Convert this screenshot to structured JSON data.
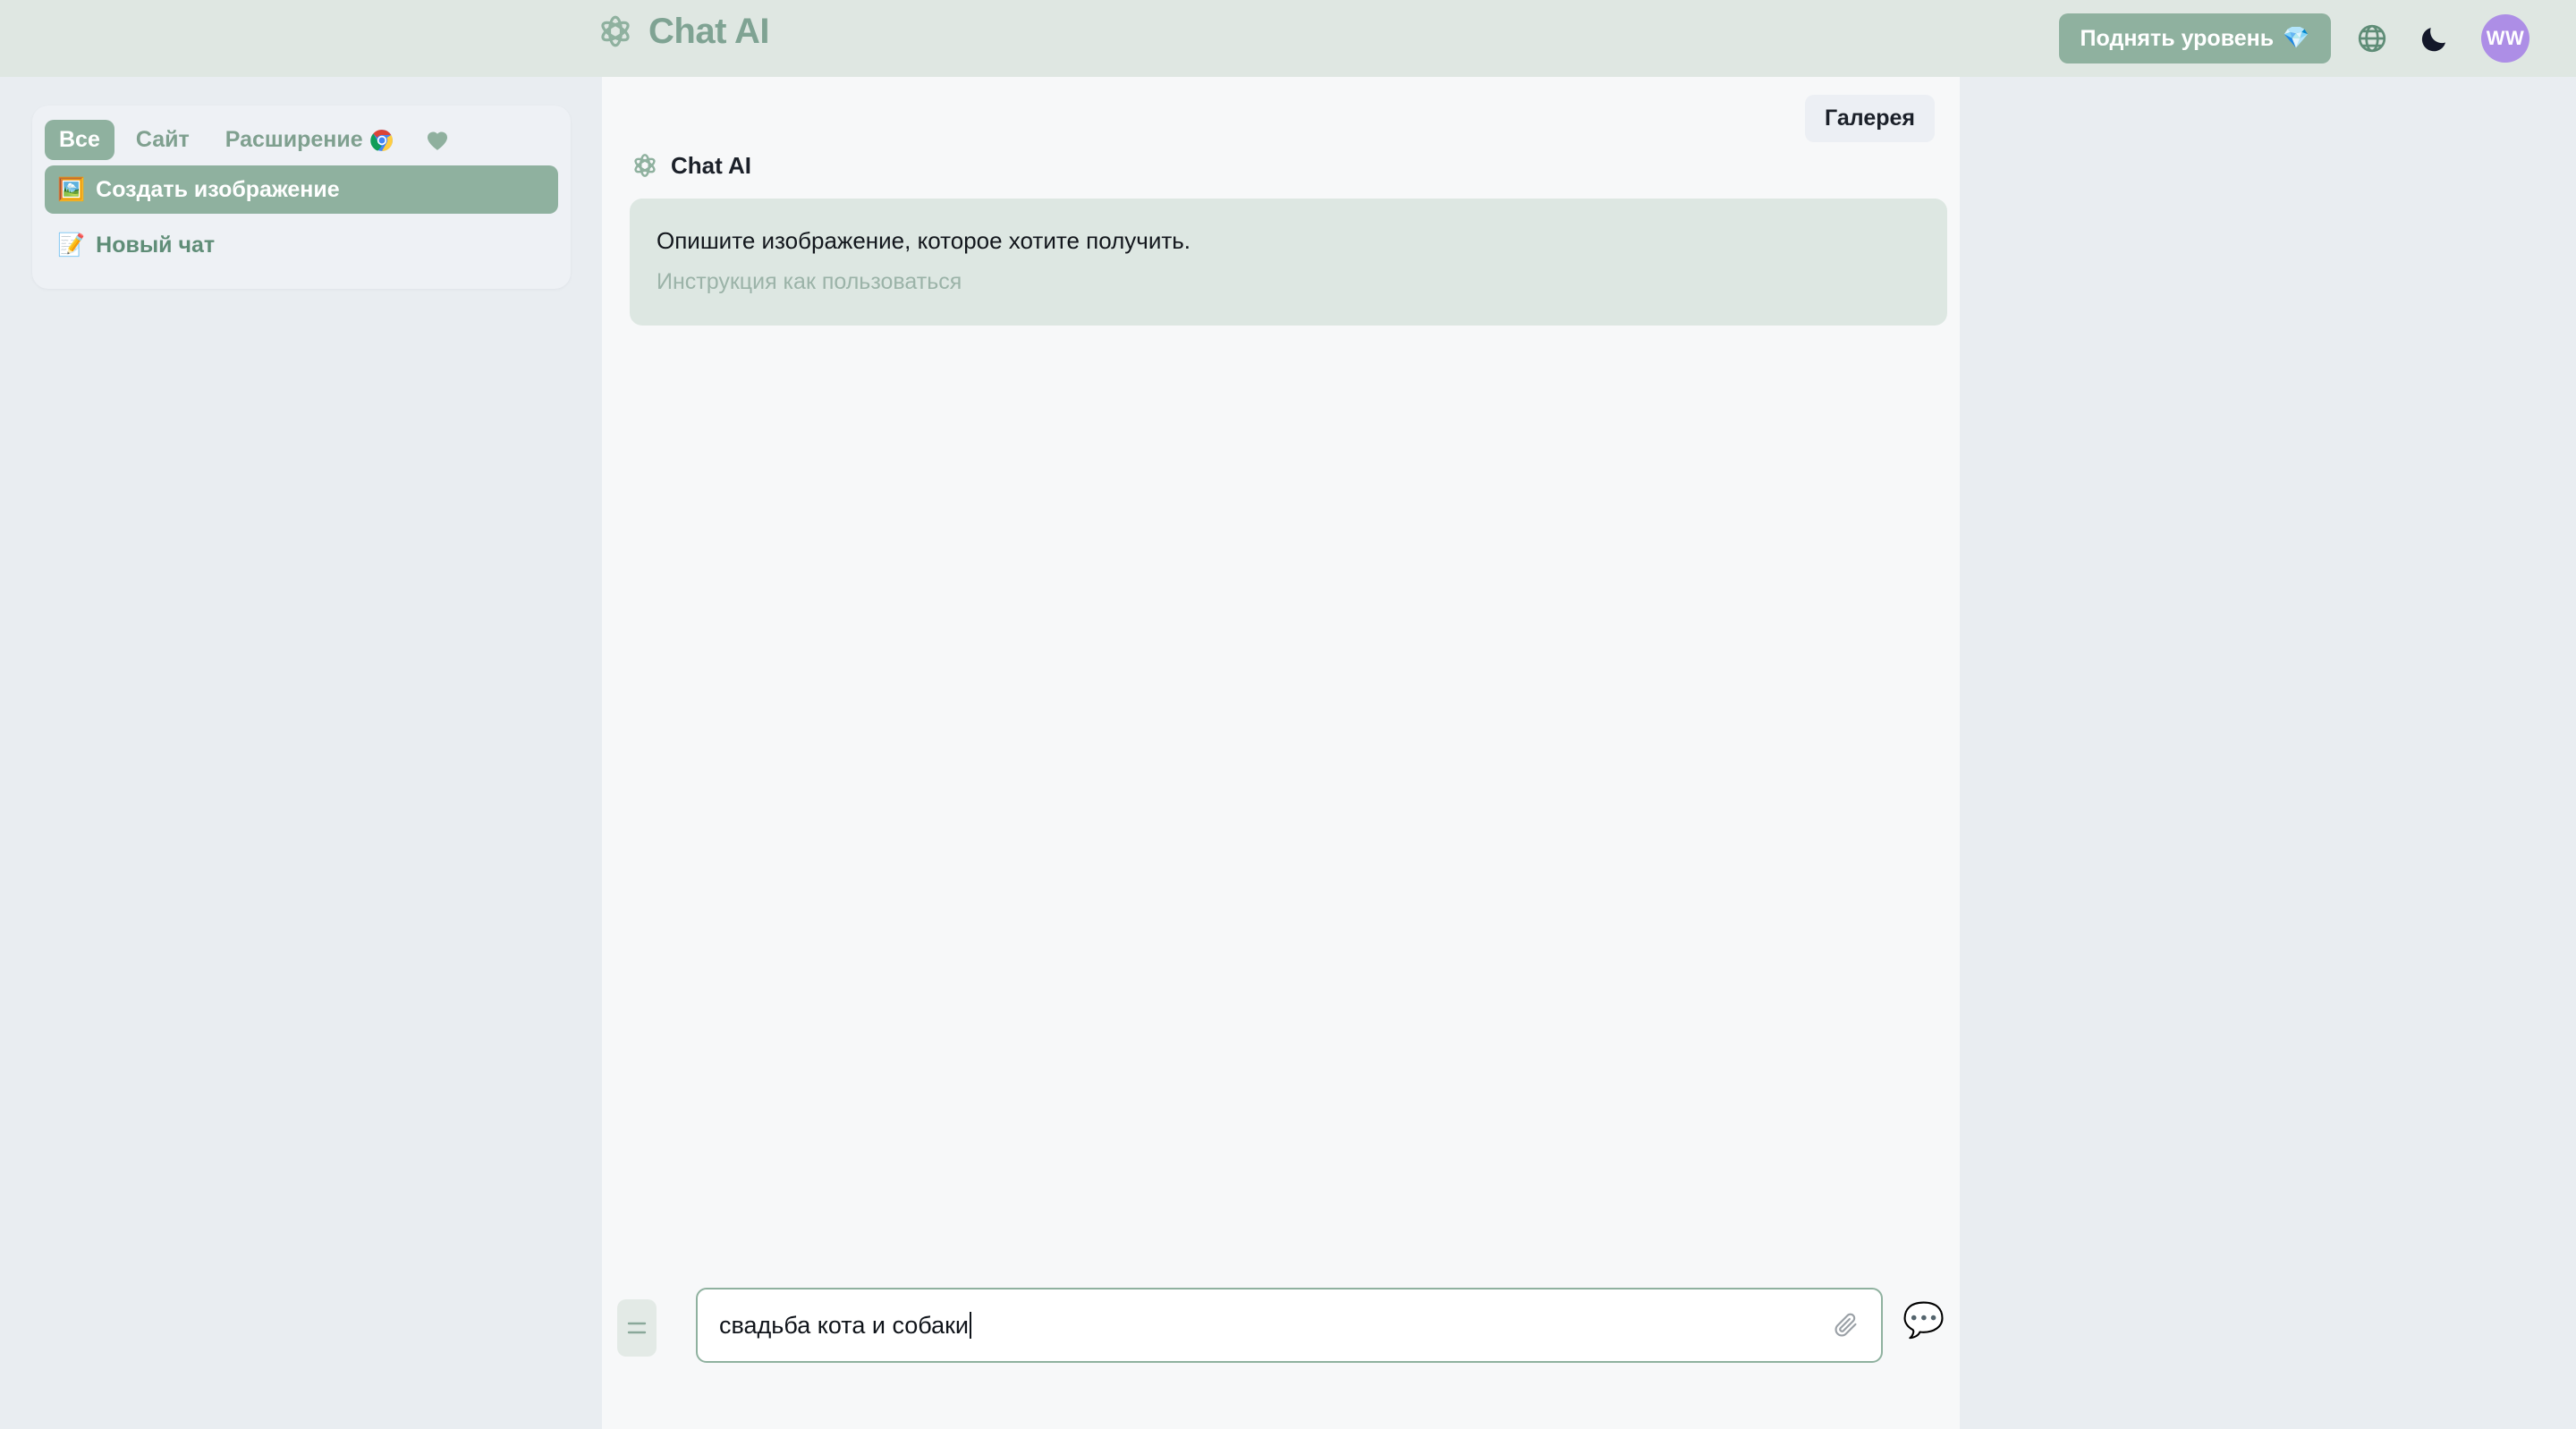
{
  "header": {
    "brand_name": "Chat AI",
    "brand_logo_icon": "openai-knot-icon",
    "upgrade_label": "Поднять уровень",
    "upgrade_emoji": "💎",
    "language_icon": "globe-icon",
    "theme_icon": "moon-icon",
    "avatar_initials": "WW"
  },
  "sidebar": {
    "tabs": [
      {
        "label": "Все",
        "active": true
      },
      {
        "label": "Сайт",
        "active": false
      },
      {
        "label": "Расширение",
        "active": false,
        "icon": "chrome-icon"
      },
      {
        "label": "",
        "active": false,
        "icon": "heart-icon"
      }
    ],
    "items": [
      {
        "emoji": "🖼️",
        "label": "Создать изображение",
        "active": true
      },
      {
        "emoji": "📝",
        "label": "Новый чат",
        "active": false
      }
    ]
  },
  "chat": {
    "gallery_label": "Галерея",
    "message": {
      "author": "Chat AI",
      "author_logo_icon": "openai-knot-icon",
      "text": "Опишите изображение, которое хотите получить.",
      "link_label": "Инструкция как пользоваться"
    }
  },
  "composer": {
    "menu_icon": "hamburger-menu-icon",
    "input_value": "свадьба кота и собаки",
    "input_placeholder": "",
    "attach_icon": "paperclip-icon",
    "action_emoji": "💬"
  },
  "colors": {
    "page_bg": "#e9edf1",
    "header_bg": "#dfe7e2",
    "panel_bg": "#f7f8f9",
    "sidebar_bg": "#eef1f5",
    "accent_green": "#8fb19f",
    "bubble_bg": "#dde7e2",
    "avatar_purple": "#ad8ee6",
    "text_dark": "#12161c"
  }
}
